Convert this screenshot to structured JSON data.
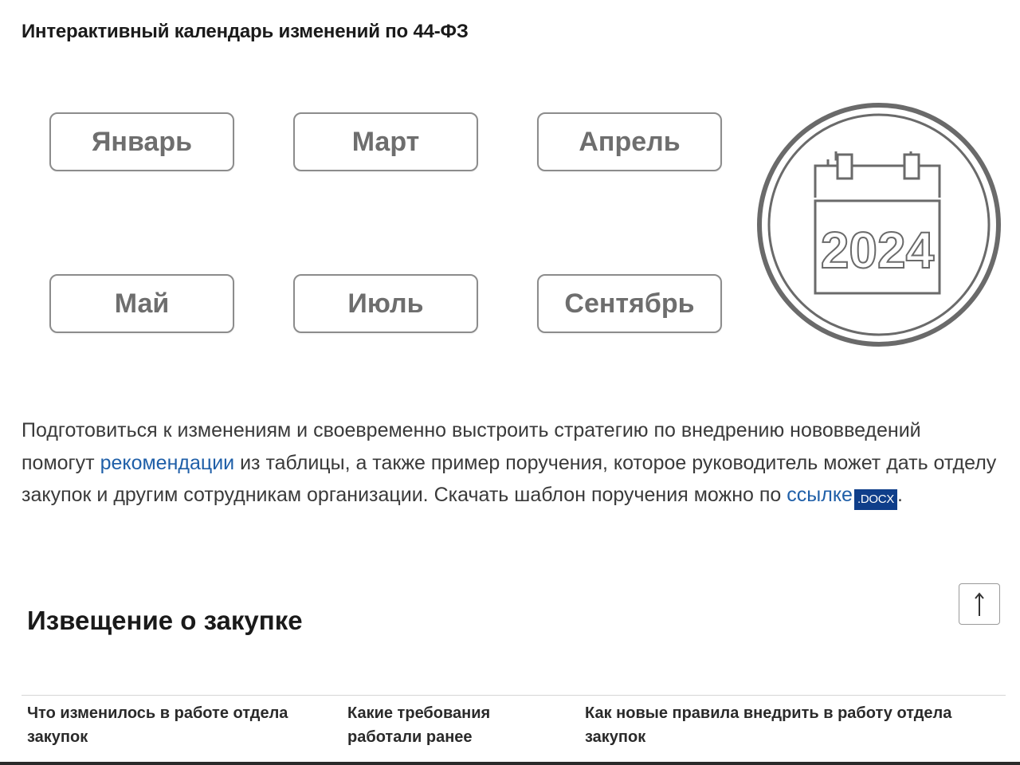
{
  "page": {
    "title": "Интерактивный календарь изменений по 44-ФЗ"
  },
  "months": [
    "Январь",
    "Март",
    "Апрель",
    "Май",
    "Июль",
    "Сентябрь"
  ],
  "year_badge": {
    "year": "2024",
    "icon": "calendar-icon"
  },
  "intro": {
    "text_before_link1": "Подготовиться к изменениям и своевременно выстроить стратегию по внедрению нововведений помогут ",
    "link1": "рекомендации",
    "text_after_link1": " из таблицы, а также пример поручения, которое руководитель может дать отделу закупок и другим сотрудникам организации. Скачать шаблон поручения можно по ",
    "link2": "ссылке",
    "file_badge": ".docx",
    "text_end": "."
  },
  "scroll_top": {
    "icon": "arrow-up-icon"
  },
  "section": {
    "title": "Извещение о закупке"
  },
  "table": {
    "columns": [
      "Что изменилось в работе отдела закупок",
      "Какие требования работали ранее",
      "Как новые правила внедрить в работу отдела закупок"
    ]
  },
  "colors": {
    "link": "#1f5fa8",
    "file_badge_bg": "#0f3e8a",
    "month_text": "#6e6e6e",
    "month_border": "#8c8c8c",
    "badge_stroke": "#6a6a6a"
  }
}
